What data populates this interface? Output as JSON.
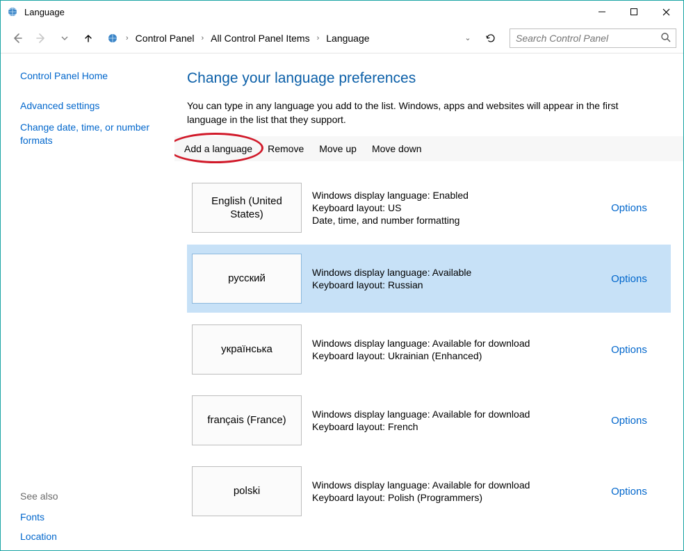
{
  "window": {
    "title": "Language"
  },
  "breadcrumb": {
    "items": [
      "Control Panel",
      "All Control Panel Items",
      "Language"
    ]
  },
  "search": {
    "placeholder": "Search Control Panel"
  },
  "sidebar": {
    "home": "Control Panel Home",
    "links": [
      "Advanced settings",
      "Change date, time, or number formats"
    ],
    "see_also_heading": "See also",
    "see_also": [
      "Fonts",
      "Location"
    ]
  },
  "main": {
    "heading": "Change your language preferences",
    "intro": "You can type in any language you add to the list. Windows, apps and websites will appear in the first language in the list that they support."
  },
  "toolbar": {
    "add": "Add a language",
    "remove": "Remove",
    "move_up": "Move up",
    "move_down": "Move down"
  },
  "options_label": "Options",
  "languages": [
    {
      "name": "English (United States)",
      "selected": false,
      "lines": [
        "Windows display language: Enabled",
        "Keyboard layout: US",
        "Date, time, and number formatting"
      ]
    },
    {
      "name": "русский",
      "selected": true,
      "lines": [
        "Windows display language: Available",
        "Keyboard layout: Russian"
      ]
    },
    {
      "name": "українська",
      "selected": false,
      "lines": [
        "Windows display language: Available for download",
        "Keyboard layout: Ukrainian (Enhanced)"
      ]
    },
    {
      "name": "français (France)",
      "selected": false,
      "lines": [
        "Windows display language: Available for download",
        "Keyboard layout: French"
      ]
    },
    {
      "name": "polski",
      "selected": false,
      "lines": [
        "Windows display language: Available for download",
        "Keyboard layout: Polish (Programmers)"
      ]
    }
  ]
}
